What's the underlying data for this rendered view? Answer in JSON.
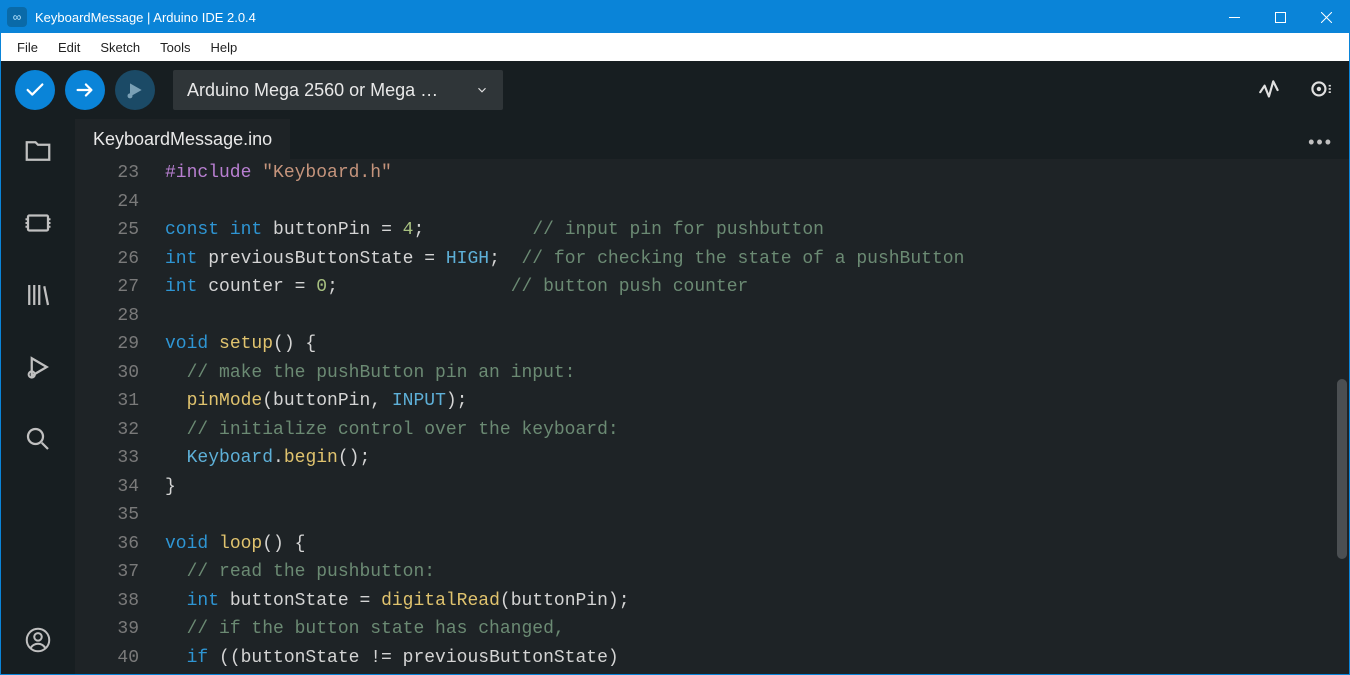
{
  "window": {
    "title": "KeyboardMessage | Arduino IDE 2.0.4"
  },
  "menu": {
    "items": [
      "File",
      "Edit",
      "Sketch",
      "Tools",
      "Help"
    ]
  },
  "toolbar": {
    "board": "Arduino Mega 2560 or Mega …"
  },
  "tabs": {
    "active": "KeyboardMessage.ino"
  },
  "editor": {
    "first_line": 23,
    "lines": [
      [
        [
          "preproc",
          "#include "
        ],
        [
          "string",
          "\"Keyboard.h\""
        ]
      ],
      [],
      [
        [
          "keyword",
          "const "
        ],
        [
          "type",
          "int "
        ],
        [
          "ident",
          "buttonPin "
        ],
        [
          "op",
          "= "
        ],
        [
          "number",
          "4"
        ],
        [
          "punct",
          ";          "
        ],
        [
          "comment",
          "// input pin for pushbutton"
        ]
      ],
      [
        [
          "type",
          "int "
        ],
        [
          "ident",
          "previousButtonState "
        ],
        [
          "op",
          "= "
        ],
        [
          "const",
          "HIGH"
        ],
        [
          "punct",
          ";  "
        ],
        [
          "comment",
          "// for checking the state of a pushButton"
        ]
      ],
      [
        [
          "type",
          "int "
        ],
        [
          "ident",
          "counter "
        ],
        [
          "op",
          "= "
        ],
        [
          "number",
          "0"
        ],
        [
          "punct",
          ";                "
        ],
        [
          "comment",
          "// button push counter"
        ]
      ],
      [],
      [
        [
          "type",
          "void "
        ],
        [
          "func",
          "setup"
        ],
        [
          "punct",
          "() {"
        ]
      ],
      [
        [
          "punct",
          "  "
        ],
        [
          "comment",
          "// make the pushButton pin an input:"
        ]
      ],
      [
        [
          "punct",
          "  "
        ],
        [
          "call",
          "pinMode"
        ],
        [
          "punct",
          "(buttonPin, "
        ],
        [
          "const",
          "INPUT"
        ],
        [
          "punct",
          ");"
        ]
      ],
      [
        [
          "punct",
          "  "
        ],
        [
          "comment",
          "// initialize control over the keyboard:"
        ]
      ],
      [
        [
          "punct",
          "  "
        ],
        [
          "const",
          "Keyboard"
        ],
        [
          "punct",
          "."
        ],
        [
          "call",
          "begin"
        ],
        [
          "punct",
          "();"
        ]
      ],
      [
        [
          "punct",
          "}"
        ]
      ],
      [],
      [
        [
          "type",
          "void "
        ],
        [
          "func",
          "loop"
        ],
        [
          "punct",
          "() {"
        ]
      ],
      [
        [
          "punct",
          "  "
        ],
        [
          "comment",
          "// read the pushbutton:"
        ]
      ],
      [
        [
          "punct",
          "  "
        ],
        [
          "type",
          "int "
        ],
        [
          "ident",
          "buttonState "
        ],
        [
          "op",
          "= "
        ],
        [
          "call",
          "digitalRead"
        ],
        [
          "punct",
          "(buttonPin);"
        ]
      ],
      [
        [
          "punct",
          "  "
        ],
        [
          "comment",
          "// if the button state has changed,"
        ]
      ],
      [
        [
          "punct",
          "  "
        ],
        [
          "keyword",
          "if "
        ],
        [
          "punct",
          "((buttonState "
        ],
        [
          "op",
          "!= "
        ],
        [
          "ident",
          "previousButtonState"
        ],
        [
          "punct",
          ")"
        ]
      ]
    ]
  }
}
